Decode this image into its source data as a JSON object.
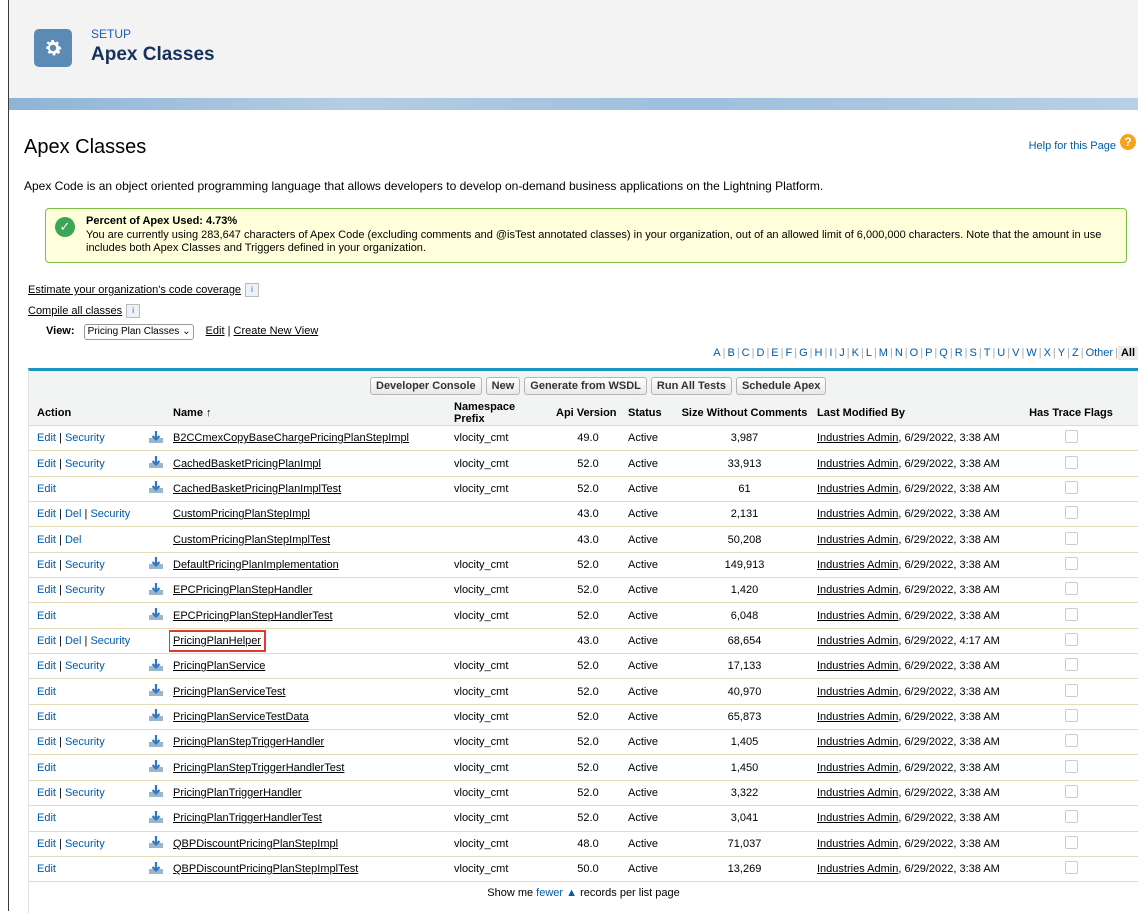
{
  "header": {
    "eyebrow": "SETUP",
    "title": "Apex Classes"
  },
  "page": {
    "title": "Apex Classes",
    "help_link": "Help for this Page",
    "description": "Apex Code is an object oriented programming language that allows developers to develop on-demand business applications on the Lightning Platform."
  },
  "notice": {
    "heading": "Percent of Apex Used: 4.73%",
    "text": "You are currently using 283,647 characters of Apex Code (excluding comments and @isTest annotated classes) in your organization, out of an allowed limit of 6,000,000 characters. Note that the amount in use includes both Apex Classes and Triggers defined in your organization."
  },
  "links": {
    "estimate": "Estimate your organization's code coverage",
    "compile": "Compile all classes"
  },
  "view": {
    "label": "View:",
    "selected": "Pricing Plan Classes",
    "edit": "Edit",
    "separator": "|",
    "create": "Create New View"
  },
  "alphabet": [
    "A",
    "B",
    "C",
    "D",
    "E",
    "F",
    "G",
    "H",
    "I",
    "J",
    "K",
    "L",
    "M",
    "N",
    "O",
    "P",
    "Q",
    "R",
    "S",
    "T",
    "U",
    "V",
    "W",
    "X",
    "Y",
    "Z",
    "Other",
    "All"
  ],
  "buttons": [
    "Developer Console",
    "New",
    "Generate from WSDL",
    "Run All Tests",
    "Schedule Apex"
  ],
  "columns": {
    "action": "Action",
    "name": "Name ↑",
    "namespace": "Namespace Prefix",
    "api": "Api Version",
    "status": "Status",
    "size": "Size Without Comments",
    "modified": "Last Modified By",
    "trace": "Has Trace Flags"
  },
  "rows": [
    {
      "actions": [
        "Edit",
        "Security"
      ],
      "managed": true,
      "name": "B2CCmexCopyBaseChargePricingPlanStepImpl",
      "namespace": "vlocity_cmt",
      "api": "49.0",
      "status": "Active",
      "size": "3,987",
      "modified_by": "Industries Admin",
      "modified_date": ", 6/29/2022, 3:38 AM",
      "highlight": false
    },
    {
      "actions": [
        "Edit",
        "Security"
      ],
      "managed": true,
      "name": "CachedBasketPricingPlanImpl",
      "namespace": "vlocity_cmt",
      "api": "52.0",
      "status": "Active",
      "size": "33,913",
      "modified_by": "Industries Admin",
      "modified_date": ", 6/29/2022, 3:38 AM",
      "highlight": false
    },
    {
      "actions": [
        "Edit"
      ],
      "managed": true,
      "name": "CachedBasketPricingPlanImplTest",
      "namespace": "vlocity_cmt",
      "api": "52.0",
      "status": "Active",
      "size": "61",
      "modified_by": "Industries Admin",
      "modified_date": ", 6/29/2022, 3:38 AM",
      "highlight": false
    },
    {
      "actions": [
        "Edit",
        "Del",
        "Security"
      ],
      "managed": false,
      "name": "CustomPricingPlanStepImpl",
      "namespace": "",
      "api": "43.0",
      "status": "Active",
      "size": "2,131",
      "modified_by": "Industries Admin",
      "modified_date": ", 6/29/2022, 3:38 AM",
      "highlight": false
    },
    {
      "actions": [
        "Edit",
        "Del"
      ],
      "managed": false,
      "name": "CustomPricingPlanStepImplTest",
      "namespace": "",
      "api": "43.0",
      "status": "Active",
      "size": "50,208",
      "modified_by": "Industries Admin",
      "modified_date": ", 6/29/2022, 3:38 AM",
      "highlight": false
    },
    {
      "actions": [
        "Edit",
        "Security"
      ],
      "managed": true,
      "name": "DefaultPricingPlanImplementation",
      "namespace": "vlocity_cmt",
      "api": "52.0",
      "status": "Active",
      "size": "149,913",
      "modified_by": "Industries Admin",
      "modified_date": ", 6/29/2022, 3:38 AM",
      "highlight": false
    },
    {
      "actions": [
        "Edit",
        "Security"
      ],
      "managed": true,
      "name": "EPCPricingPlanStepHandler",
      "namespace": "vlocity_cmt",
      "api": "52.0",
      "status": "Active",
      "size": "1,420",
      "modified_by": "Industries Admin",
      "modified_date": ", 6/29/2022, 3:38 AM",
      "highlight": false
    },
    {
      "actions": [
        "Edit"
      ],
      "managed": true,
      "name": "EPCPricingPlanStepHandlerTest",
      "namespace": "vlocity_cmt",
      "api": "52.0",
      "status": "Active",
      "size": "6,048",
      "modified_by": "Industries Admin",
      "modified_date": ", 6/29/2022, 3:38 AM",
      "highlight": false
    },
    {
      "actions": [
        "Edit",
        "Del",
        "Security"
      ],
      "managed": false,
      "name": "PricingPlanHelper",
      "namespace": "",
      "api": "43.0",
      "status": "Active",
      "size": "68,654",
      "modified_by": "Industries Admin",
      "modified_date": ", 6/29/2022, 4:17 AM",
      "highlight": true
    },
    {
      "actions": [
        "Edit",
        "Security"
      ],
      "managed": true,
      "name": "PricingPlanService",
      "namespace": "vlocity_cmt",
      "api": "52.0",
      "status": "Active",
      "size": "17,133",
      "modified_by": "Industries Admin",
      "modified_date": ", 6/29/2022, 3:38 AM",
      "highlight": false
    },
    {
      "actions": [
        "Edit"
      ],
      "managed": true,
      "name": "PricingPlanServiceTest",
      "namespace": "vlocity_cmt",
      "api": "52.0",
      "status": "Active",
      "size": "40,970",
      "modified_by": "Industries Admin",
      "modified_date": ", 6/29/2022, 3:38 AM",
      "highlight": false
    },
    {
      "actions": [
        "Edit"
      ],
      "managed": true,
      "name": "PricingPlanServiceTestData",
      "namespace": "vlocity_cmt",
      "api": "52.0",
      "status": "Active",
      "size": "65,873",
      "modified_by": "Industries Admin",
      "modified_date": ", 6/29/2022, 3:38 AM",
      "highlight": false
    },
    {
      "actions": [
        "Edit",
        "Security"
      ],
      "managed": true,
      "name": "PricingPlanStepTriggerHandler",
      "namespace": "vlocity_cmt",
      "api": "52.0",
      "status": "Active",
      "size": "1,405",
      "modified_by": "Industries Admin",
      "modified_date": ", 6/29/2022, 3:38 AM",
      "highlight": false
    },
    {
      "actions": [
        "Edit"
      ],
      "managed": true,
      "name": "PricingPlanStepTriggerHandlerTest",
      "namespace": "vlocity_cmt",
      "api": "52.0",
      "status": "Active",
      "size": "1,450",
      "modified_by": "Industries Admin",
      "modified_date": ", 6/29/2022, 3:38 AM",
      "highlight": false
    },
    {
      "actions": [
        "Edit",
        "Security"
      ],
      "managed": true,
      "name": "PricingPlanTriggerHandler",
      "namespace": "vlocity_cmt",
      "api": "52.0",
      "status": "Active",
      "size": "3,322",
      "modified_by": "Industries Admin",
      "modified_date": ", 6/29/2022, 3:38 AM",
      "highlight": false
    },
    {
      "actions": [
        "Edit"
      ],
      "managed": true,
      "name": "PricingPlanTriggerHandlerTest",
      "namespace": "vlocity_cmt",
      "api": "52.0",
      "status": "Active",
      "size": "3,041",
      "modified_by": "Industries Admin",
      "modified_date": ", 6/29/2022, 3:38 AM",
      "highlight": false
    },
    {
      "actions": [
        "Edit",
        "Security"
      ],
      "managed": true,
      "name": "QBPDiscountPricingPlanStepImpl",
      "namespace": "vlocity_cmt",
      "api": "48.0",
      "status": "Active",
      "size": "71,037",
      "modified_by": "Industries Admin",
      "modified_date": ", 6/29/2022, 3:38 AM",
      "highlight": false
    },
    {
      "actions": [
        "Edit"
      ],
      "managed": true,
      "name": "QBPDiscountPricingPlanStepImplTest",
      "namespace": "vlocity_cmt",
      "api": "50.0",
      "status": "Active",
      "size": "13,269",
      "modified_by": "Industries Admin",
      "modified_date": ", 6/29/2022, 3:38 AM",
      "highlight": false
    }
  ],
  "footer": {
    "prefix": "Show me ",
    "link": "fewer",
    "suffix": " records per list page"
  },
  "colors": {
    "accent": "#1797c0",
    "link": "#015ba7",
    "highlight": "#e03a2e",
    "notice_border": "#7bc043"
  }
}
